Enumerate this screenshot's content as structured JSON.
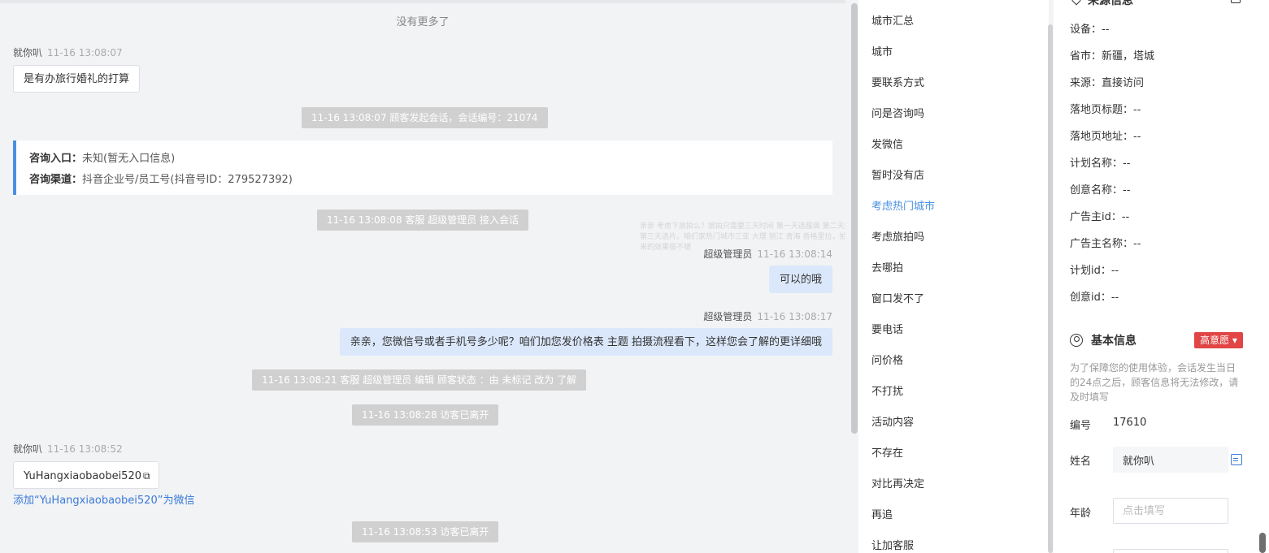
{
  "chat": {
    "no_more": "没有更多了",
    "messages": [
      {
        "sender": "就你叭",
        "time": "11-16 13:08:07",
        "text": "是有办旅行婚礼的打算"
      },
      {
        "sys": "11-16 13:08:07 顾客发起会话，会话编号：21074"
      },
      {
        "entry_label": "咨询入口：",
        "entry_value": "未知(暂无入口信息)",
        "channel_label": "咨询渠道：",
        "channel_value": "抖音企业号/员工号(抖音号ID：279527392)"
      },
      {
        "sys": "11-16 13:08:08 客服 超级管理员 接入会话"
      },
      {
        "sender": "超级管理员",
        "time": "11-16 13:08:14",
        "text": "可以的哦"
      },
      {
        "sender": "超级管理员",
        "time": "11-16 13:08:17",
        "text": "亲亲，您微信号或者手机号多少呢？咱们加您发价格表 主题 拍摄流程看下，这样您会了解的更详细哦"
      },
      {
        "sys": "11-16 13:08:21 客服 超级管理员 编辑 顾客状态 ：由 未标记 改为 了解"
      },
      {
        "sys": "11-16 13:08:28 访客已离开"
      },
      {
        "sender": "就你叭",
        "time": "11-16 13:08:52",
        "text": "YuHangxiaobaobei520"
      },
      {
        "link": "添加“YuHangxiaobaobei520”为微信"
      },
      {
        "sys": "11-16 13:08:53 访客已离开"
      }
    ],
    "ghost_text": "亲亲 考虑下旅拍么？旅拍只需要三天时间 第一天选服装 第二天拍摄 第三天选片。咱们家热门城市三亚 大理 丽江 青海 香格里拉，拍出来的效果很不错"
  },
  "phrases": {
    "items": [
      "城市汇总",
      "城市",
      "要联系方式",
      "问是咨询吗",
      "发微信",
      "暂时没有店",
      "考虑热门城市",
      "考虑旅拍吗",
      "去哪拍",
      "窗口发不了",
      "要电话",
      "问价格",
      "不打扰",
      "活动内容",
      "不存在",
      "对比再决定",
      "再追",
      "让加客服"
    ],
    "active_index": 6
  },
  "source_info": {
    "title": "来源信息",
    "fields": [
      "设备：--",
      "省市：新疆，塔城",
      "来源：直接访问",
      "落地页标题：--",
      "落地页地址：--",
      "计划名称：--",
      "创意名称：--",
      "广告主id：--",
      "广告主名称：--",
      "计划id：--",
      "创意id：--"
    ]
  },
  "basic_info": {
    "title": "基本信息",
    "tag": "高意愿 ▾",
    "note": "为了保障您的使用体验，会话发生当日的24点之后，顾客信息将无法修改，请及时填写",
    "id_label": "编号",
    "id_value": "17610",
    "name_label": "姓名",
    "name_value": "就你叭",
    "age_label": "年龄",
    "age_placeholder": "点击填写"
  },
  "colors": {
    "accent": "#4a90e2",
    "tag": "#e14545",
    "bubble_blue": "#dbe8fb",
    "sys_bg": "#d0d0d0"
  }
}
